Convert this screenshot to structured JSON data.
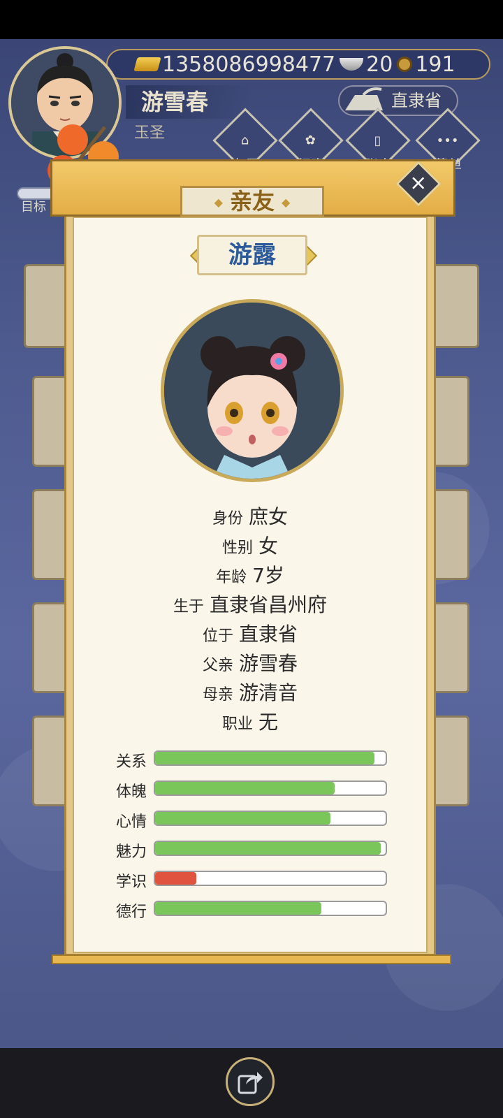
{
  "player": {
    "name": "游雪春",
    "title": "玉圣",
    "location": "直隶省"
  },
  "currency": {
    "gold": "1358086998477",
    "silver": "20",
    "coins": "191"
  },
  "menu": {
    "items": [
      "东风",
      "行事",
      "账本",
      "菜单"
    ]
  },
  "goal_label": "目标",
  "dialog": {
    "title": "亲友",
    "friend_name": "游露",
    "info": [
      {
        "key": "身份",
        "value": "庶女"
      },
      {
        "key": "性别",
        "value": "女"
      },
      {
        "key": "年龄",
        "value": "7岁"
      },
      {
        "key": "生于",
        "value": "直隶省昌州府"
      },
      {
        "key": "位于",
        "value": "直隶省"
      },
      {
        "key": "父亲",
        "value": "游雪春"
      },
      {
        "key": "母亲",
        "value": "游清音"
      },
      {
        "key": "职业",
        "value": "无"
      }
    ],
    "stats": [
      {
        "label": "关系",
        "fraction": 0.95,
        "color": "#7ac65a"
      },
      {
        "label": "体魄",
        "fraction": 0.78,
        "color": "#7ac65a"
      },
      {
        "label": "心情",
        "fraction": 0.76,
        "color": "#7ac65a"
      },
      {
        "label": "魅力",
        "fraction": 0.98,
        "color": "#7ac65a"
      },
      {
        "label": "学识",
        "fraction": 0.18,
        "color": "#e0533f"
      },
      {
        "label": "德行",
        "fraction": 0.72,
        "color": "#7ac65a"
      }
    ]
  }
}
